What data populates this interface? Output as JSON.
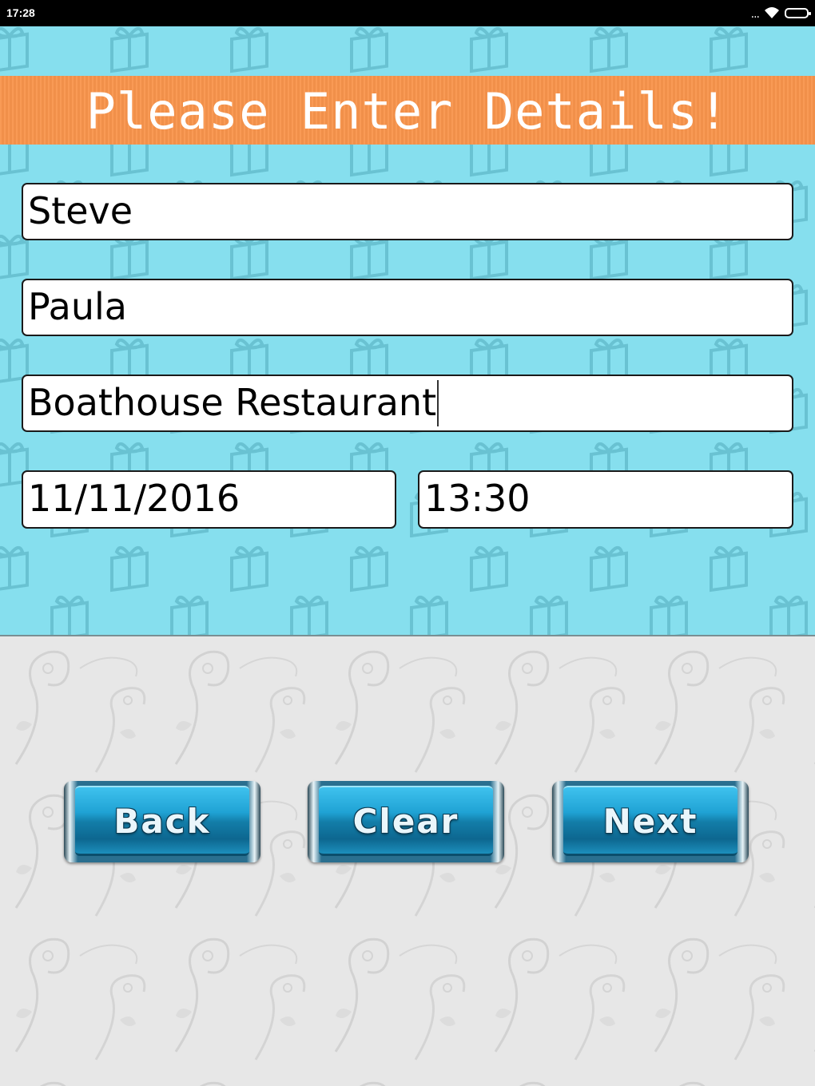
{
  "status_bar": {
    "time": "17:28",
    "overflow_indicator": "...",
    "icons": [
      "wifi-icon",
      "battery-icon"
    ]
  },
  "header": {
    "title": "Please Enter Details!"
  },
  "form": {
    "name1": "Steve",
    "name2": "Paula",
    "venue": "Boathouse Restaurant",
    "date": "11/11/2016",
    "time": "13:30"
  },
  "buttons": {
    "back_label": "Back",
    "clear_label": "Clear",
    "next_label": "Next"
  },
  "colors": {
    "header_banner": "#f9954c",
    "top_background": "#86dfee",
    "gift_pattern": "#5fb8c9",
    "bottom_background": "#e7e7e7",
    "button_blue": "#1fa2d4"
  },
  "decorations": {
    "top_pattern": "gift-box-pattern",
    "bottom_pattern": "floral-swirl-pattern"
  }
}
